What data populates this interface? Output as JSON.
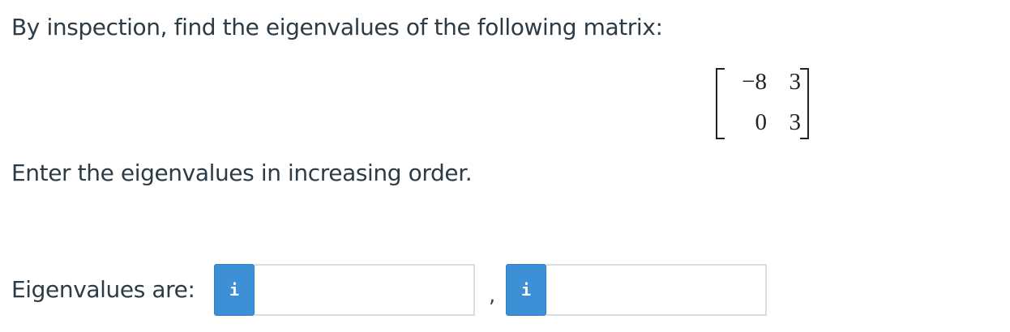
{
  "question": {
    "prompt": "By inspection, find the eigenvalues of the following matrix:",
    "matrix": [
      [
        "−8",
        "3"
      ],
      [
        "0",
        "3"
      ]
    ],
    "instruction": "Enter the eigenvalues in increasing order."
  },
  "answer": {
    "label": "Eigenvalues are:",
    "info_icon": "i",
    "separator": ",",
    "inputs": [
      {
        "value": "",
        "placeholder": ""
      },
      {
        "value": "",
        "placeholder": ""
      }
    ]
  },
  "colors": {
    "text": "#2d3b45",
    "info_button": "#3d8fd6",
    "input_border": "#d9dde0"
  },
  "icons": {
    "info": "info-icon"
  }
}
